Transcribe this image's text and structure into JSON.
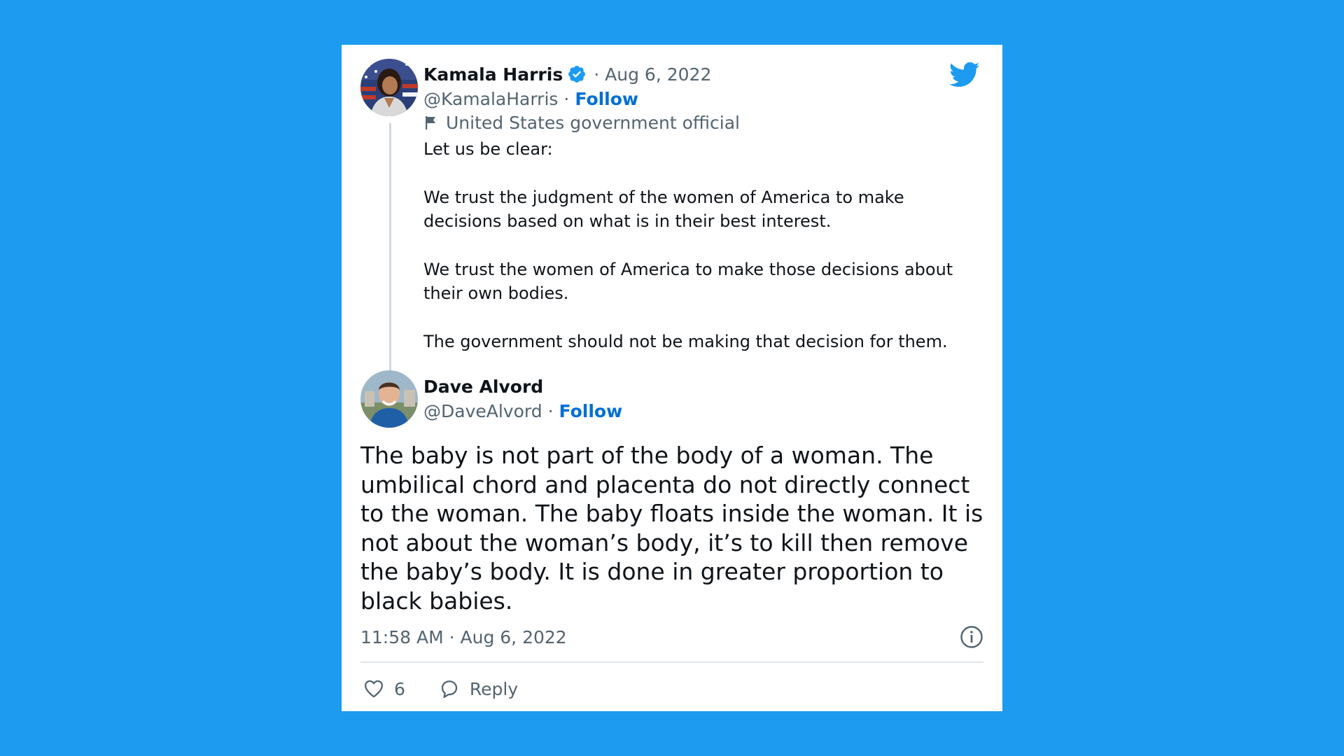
{
  "colors": {
    "background": "#1d9bf0",
    "card": "#ffffff",
    "follow": "#006fd6",
    "muted": "#536471",
    "text": "#0f1419"
  },
  "tweet1": {
    "author_name": "Kamala Harris",
    "verified": true,
    "separator": "·",
    "date": "Aug 6, 2022",
    "handle": "@KamalaHarris",
    "follow_label": "Follow",
    "affiliation_icon": "flag-icon",
    "affiliation": "United States government official",
    "paragraphs": [
      "Let us be clear:",
      "We trust the judgment of the women of America to make decisions based on what is in their best interest.",
      "We trust the women of America to make those decisions about their own bodies.",
      "The government should not be making that decision for them."
    ]
  },
  "tweet2": {
    "author_name": "Dave Alvord",
    "handle": "@DaveAlvord",
    "separator": "·",
    "follow_label": "Follow",
    "text": "The baby is not part of the body of a woman. The umbilical chord and placenta do not directly connect to the woman. The baby floats inside the woman. It is not about the woman’s body, it’s to kill then remove the baby’s body. It is done in greater proportion to black babies.",
    "timestamp": "11:58 AM · Aug 6, 2022",
    "likes": "6",
    "reply_label": "Reply"
  },
  "icons": {
    "logo": "twitter-bird-icon",
    "verified": "verified-badge-icon",
    "info": "info-icon",
    "like": "heart-icon",
    "reply": "reply-bubble-icon"
  }
}
